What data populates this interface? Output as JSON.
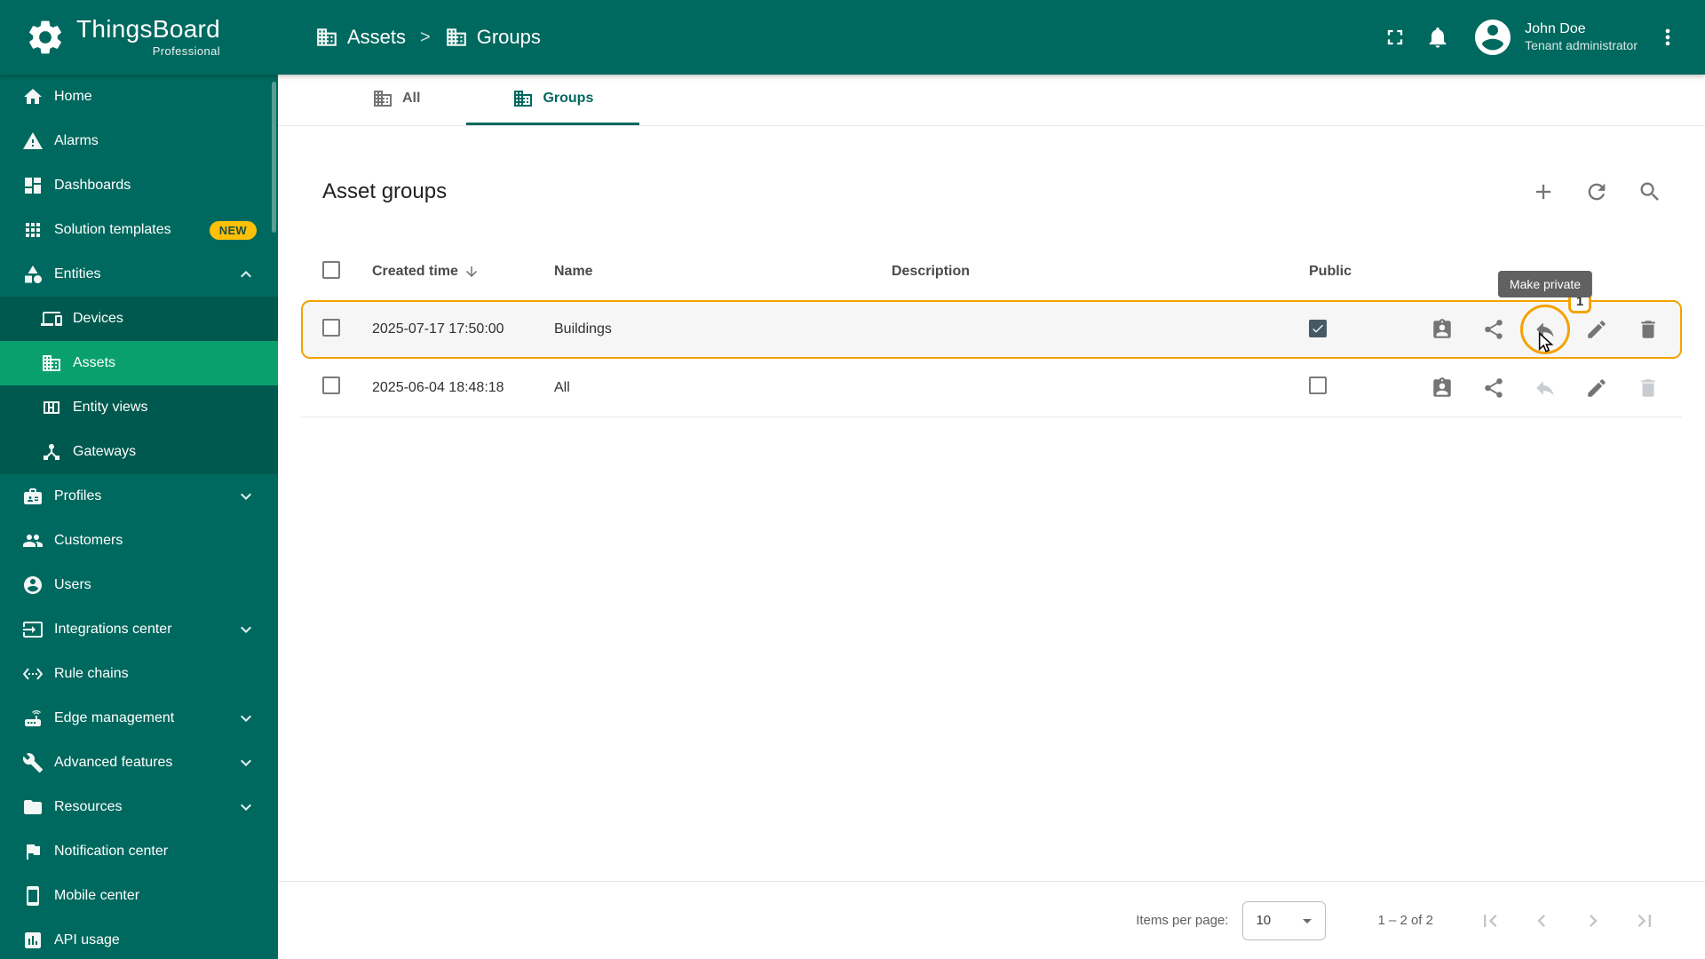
{
  "header": {
    "app_name": "ThingsBoard",
    "app_subtitle": "Professional",
    "breadcrumb_separator": ">",
    "breadcrumb": [
      {
        "label": "Assets",
        "icon": "building-icon"
      },
      {
        "label": "Groups",
        "icon": "building-icon"
      }
    ],
    "user": {
      "name": "John Doe",
      "role": "Tenant administrator"
    }
  },
  "sidebar": {
    "items": [
      {
        "label": "Home",
        "icon": "home-icon"
      },
      {
        "label": "Alarms",
        "icon": "warning-icon"
      },
      {
        "label": "Dashboards",
        "icon": "dashboard-icon"
      },
      {
        "label": "Solution templates",
        "icon": "apps-grid-icon",
        "badge": "NEW"
      },
      {
        "label": "Entities",
        "icon": "shapes-icon",
        "expanded": true
      },
      {
        "label": "Devices",
        "icon": "devices-icon",
        "sub": true
      },
      {
        "label": "Assets",
        "icon": "building-icon",
        "sub": true,
        "active": true
      },
      {
        "label": "Entity views",
        "icon": "grid-layout-icon",
        "sub": true
      },
      {
        "label": "Gateways",
        "icon": "hub-icon",
        "sub": true
      },
      {
        "label": "Profiles",
        "icon": "badge-icon",
        "collapsible": true
      },
      {
        "label": "Customers",
        "icon": "people-icon"
      },
      {
        "label": "Users",
        "icon": "person-circle-icon"
      },
      {
        "label": "Integrations center",
        "icon": "input-icon",
        "collapsible": true
      },
      {
        "label": "Rule chains",
        "icon": "code-brackets-icon"
      },
      {
        "label": "Edge management",
        "icon": "router-icon",
        "collapsible": true
      },
      {
        "label": "Advanced features",
        "icon": "wrench-icon",
        "collapsible": true
      },
      {
        "label": "Resources",
        "icon": "folder-icon",
        "collapsible": true
      },
      {
        "label": "Notification center",
        "icon": "flag-icon"
      },
      {
        "label": "Mobile center",
        "icon": "smartphone-icon"
      },
      {
        "label": "API usage",
        "icon": "bar-chart-icon"
      }
    ]
  },
  "tabs": [
    {
      "label": "All",
      "icon": "building-icon",
      "active": false
    },
    {
      "label": "Groups",
      "icon": "building-icon",
      "active": true
    }
  ],
  "content": {
    "title": "Asset groups",
    "toolbar": [
      "add-icon",
      "refresh-icon",
      "search-icon"
    ],
    "tooltip": "Make private",
    "step_badge": "1",
    "annotated_action": "make-private",
    "table": {
      "columns": [
        "Created time",
        "Name",
        "Description",
        "Public"
      ],
      "row_actions": [
        {
          "key": "manage-permissions",
          "icon": "person-card-icon"
        },
        {
          "key": "share",
          "icon": "share-icon"
        },
        {
          "key": "make-private",
          "icon": "reply-arrow-icon"
        },
        {
          "key": "edit",
          "icon": "pencil-icon"
        },
        {
          "key": "delete",
          "icon": "trash-icon"
        }
      ],
      "rows": [
        {
          "created_time": "2025-07-17 17:50:00",
          "name": "Buildings",
          "description": "",
          "public": true,
          "highlighted": true,
          "disabled_actions": []
        },
        {
          "created_time": "2025-06-04 18:48:18",
          "name": "All",
          "description": "",
          "public": false,
          "highlighted": false,
          "disabled_actions": [
            "make-private",
            "delete"
          ]
        }
      ]
    },
    "pagination": {
      "items_per_page_label": "Items per page:",
      "items_per_page_value": "10",
      "range_label": "1 – 2 of 2"
    }
  },
  "colors": {
    "primary": "#00695f",
    "primary-dark": "#00594e",
    "active-item": "#0aa06e",
    "accent": "#f5a200",
    "badge-bg": "#ffc107",
    "badge-text": "#1d4d44",
    "tooltip-bg": "#616161",
    "checkbox-checked": "#455a64",
    "icon-grey": "#757575",
    "disabled-grey": "#c9cdd1",
    "text-dark": "#2b2b2b"
  }
}
